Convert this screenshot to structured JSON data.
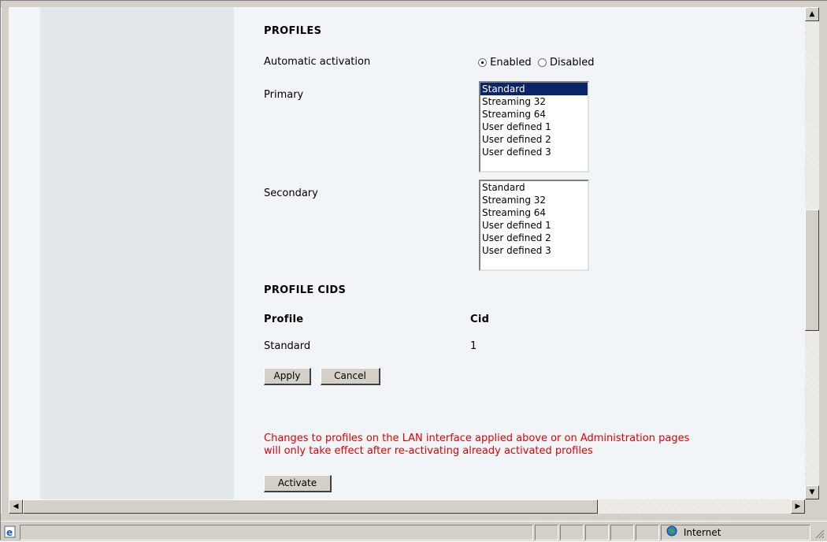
{
  "profiles": {
    "heading": "PROFILES",
    "automatic_activation": {
      "label": "Automatic activation",
      "enabled_label": "Enabled",
      "disabled_label": "Disabled",
      "selected": "Enabled"
    },
    "primary": {
      "label": "Primary",
      "options": [
        "Standard",
        "Streaming 32",
        "Streaming 64",
        "User defined 1",
        "User defined 2",
        "User defined 3"
      ],
      "selected": "Standard"
    },
    "secondary": {
      "label": "Secondary",
      "options": [
        "Standard",
        "Streaming 32",
        "Streaming 64",
        "User defined 1",
        "User defined 2",
        "User defined 3"
      ]
    }
  },
  "profile_cids": {
    "heading": "PROFILE CIDS",
    "col_profile": "Profile",
    "col_cid": "Cid",
    "rows": [
      {
        "profile": "Standard",
        "cid": "1"
      }
    ]
  },
  "buttons": {
    "apply": "Apply",
    "cancel": "Cancel",
    "activate": "Activate"
  },
  "warning": {
    "line1": "Changes to profiles on the LAN interface applied above or on Administration pages",
    "line2": "will only take effect after re-activating already activated profiles"
  },
  "status_bar": {
    "zone": "Internet"
  },
  "icons": {
    "scroll_up": "arrow-up-icon",
    "scroll_down": "arrow-down-icon",
    "scroll_left": "arrow-left-icon",
    "scroll_right": "arrow-right-icon",
    "page": "ie-page-icon",
    "globe": "globe-icon"
  }
}
